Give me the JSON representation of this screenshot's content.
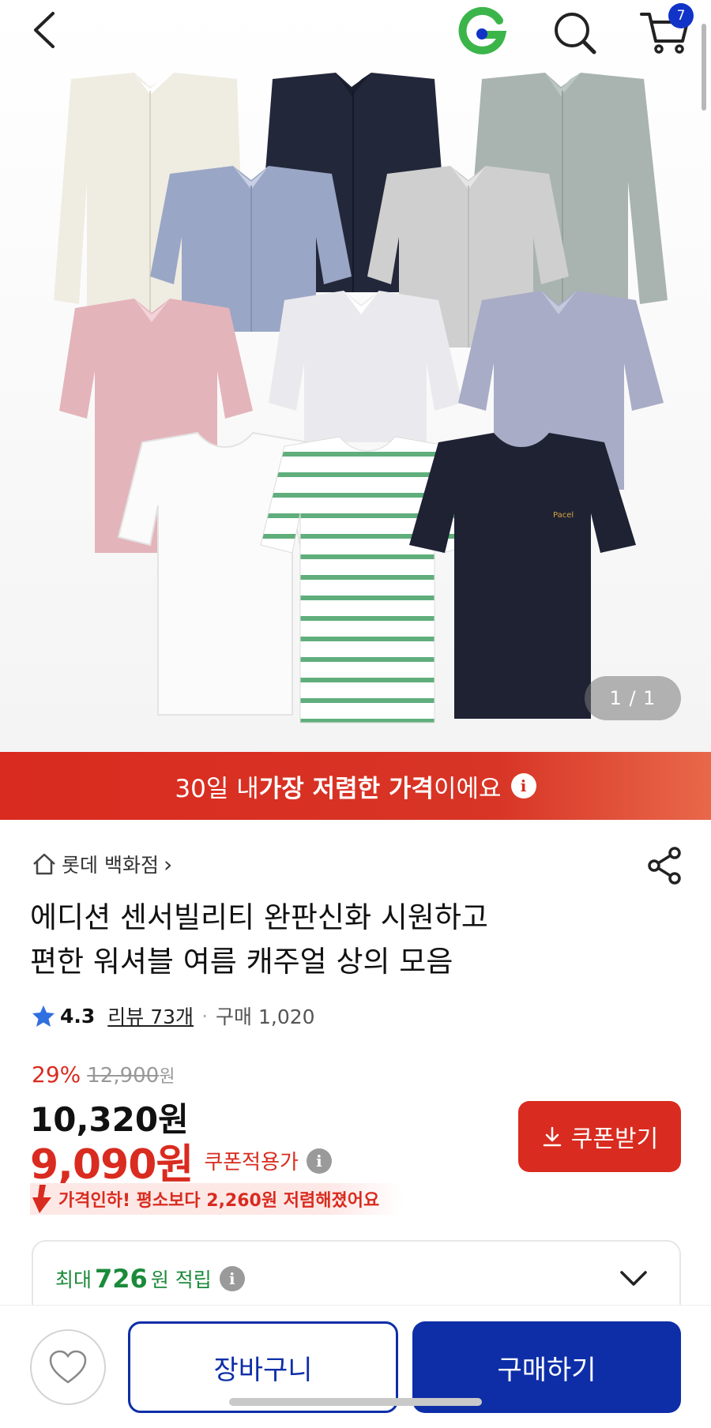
{
  "header": {
    "cart_count": "7",
    "icons": [
      "back-chevron",
      "g-logo",
      "search",
      "cart"
    ]
  },
  "product_image": {
    "counter": "1 / 1",
    "description_icons": [
      "shirts-collage"
    ]
  },
  "banner": {
    "prefix": "30일 내 ",
    "bold": "가장 저렴한 가격",
    "suffix": "이에요",
    "info": "i"
  },
  "store": {
    "name": "롯데 백화점",
    "chevron": "›"
  },
  "product": {
    "title_line1": "에디션 센서빌리티 완판신화 시원하고",
    "title_line2": "편한 워셔블 여름 캐주얼 상의 모음"
  },
  "rating": {
    "score": "4.3",
    "reviews": "리뷰 73개",
    "separator": "·",
    "purchases": "구매 1,020"
  },
  "price": {
    "discount_rate": "29%",
    "original": "12,900",
    "original_unit": "원",
    "sale": "10,320원",
    "coupon_price": "9,090원",
    "coupon_label": "쿠폰적용가",
    "info": "i",
    "coupon_button": "쿠폰받기",
    "drop_text": "가격인하! 평소보다 2,260원 저렴해졌어요"
  },
  "points": {
    "prefix": "최대",
    "amount": "726",
    "suffix": "원 적립",
    "info": "i"
  },
  "bottom_bar": {
    "cart_button": "장바구니",
    "buy_button": "구매하기"
  },
  "colors": {
    "accent_red": "#d92b1f",
    "accent_blue": "#0e2ea8",
    "points_green": "#1b8a3a"
  }
}
